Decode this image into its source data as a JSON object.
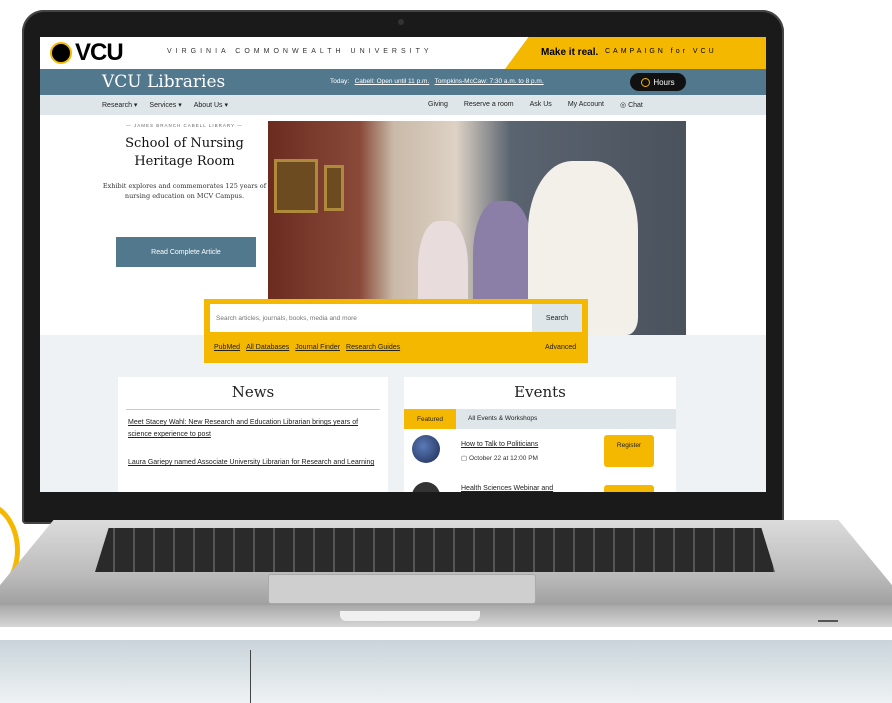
{
  "topbar": {
    "logo_text": "VCU",
    "university_name": "VIRGINIA COMMONWEALTH UNIVERSITY",
    "campaign_bold": "Make it real.",
    "campaign_rest": "CAMPAIGN for VCU"
  },
  "header": {
    "title": "VCU Libraries",
    "today_label": "Today:",
    "cabell_hours": "Cabell: Open until 11 p.m.",
    "tompkins_hours": "Tompkins-McCaw: 7:30 a.m. to 8 p.m.",
    "hours_button": "Hours"
  },
  "nav": {
    "left": [
      "Research ▾",
      "Services ▾",
      "About Us ▾"
    ],
    "right": [
      "Giving",
      "Reserve a room",
      "Ask Us",
      "My Account",
      "Chat"
    ]
  },
  "hero": {
    "kicker": "— JAMES BRANCH CABELL LIBRARY —",
    "title": "School of Nursing Heritage Room",
    "description": "Exhibit explores and commemorates 125 years of nursing education on MCV Campus.",
    "button": "Read Complete Article"
  },
  "search": {
    "placeholder": "Search articles, journals, books, media and more",
    "button": "Search",
    "quick_links": [
      "PubMed",
      "All Databases",
      "Journal Finder",
      "Research Guides"
    ],
    "advanced": "Advanced"
  },
  "news": {
    "title": "News",
    "items": [
      "Meet Stacey Wahl: New Research and Education Librarian brings years of science experience to post",
      "Laura Gariepy named Associate University Librarian for Research and Learning"
    ]
  },
  "events": {
    "title": "Events",
    "tabs": [
      "Featured",
      "All Events & Workshops"
    ],
    "items": [
      {
        "title": "How to Talk to Politicians",
        "date": "October 22 at 12:00 PM",
        "button": "Register"
      },
      {
        "title": "Health Sciences Webinar and",
        "date": "",
        "button": ""
      }
    ]
  },
  "colors": {
    "vcu_gold": "#f5b800",
    "header_blue": "#52788e",
    "nav_gray": "#dfe6ea"
  }
}
